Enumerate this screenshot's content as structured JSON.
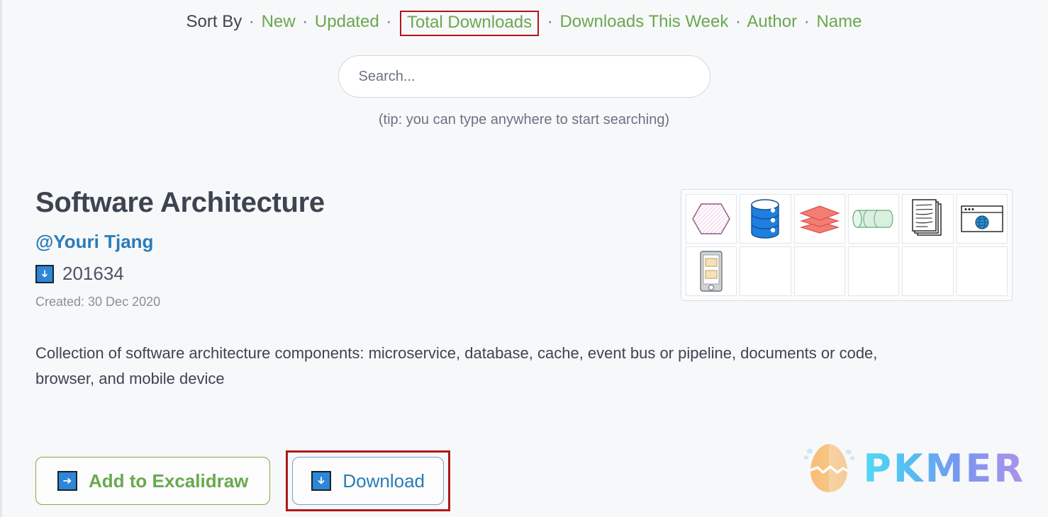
{
  "sort_bar": {
    "label": "Sort By",
    "separator": "·",
    "options": [
      {
        "label": "New",
        "active": false
      },
      {
        "label": "Updated",
        "active": false
      },
      {
        "label": "Total Downloads",
        "active": true
      },
      {
        "label": "Downloads This Week",
        "active": false
      },
      {
        "label": "Author",
        "active": false
      },
      {
        "label": "Name",
        "active": false
      }
    ]
  },
  "search": {
    "placeholder": "Search...",
    "value": "",
    "tip": "(tip: you can type anywhere to start searching)"
  },
  "item": {
    "title": "Software Architecture",
    "author": "@Youri Tjang",
    "downloads": "201634",
    "download_icon": "download-arrow-icon",
    "created": "Created: 30 Dec 2020",
    "description": "Collection of software architecture components: microservice, database, cache, event bus or pipeline, documents or code, browser, and mobile device"
  },
  "thumbnails": [
    {
      "name": "hexagon-microservice-thumb",
      "filled": true
    },
    {
      "name": "database-cylinder-thumb",
      "filled": true
    },
    {
      "name": "cache-layers-thumb",
      "filled": true
    },
    {
      "name": "pipeline-tube-thumb",
      "filled": true
    },
    {
      "name": "documents-stack-thumb",
      "filled": true
    },
    {
      "name": "browser-window-thumb",
      "filled": true
    },
    {
      "name": "mobile-device-thumb",
      "filled": true
    },
    {
      "name": "empty-slot",
      "filled": false
    },
    {
      "name": "empty-slot",
      "filled": false
    },
    {
      "name": "empty-slot",
      "filled": false
    },
    {
      "name": "empty-slot",
      "filled": false
    },
    {
      "name": "empty-slot",
      "filled": false
    }
  ],
  "actions": {
    "add_label": "Add to Excalidraw",
    "add_icon": "arrow-right-icon",
    "download_label": "Download",
    "download_icon": "download-arrow-icon",
    "download_highlighted": true
  },
  "watermark": {
    "text": "PKMER",
    "logo": "cracked-egg-logo"
  },
  "colors": {
    "page_background": "#f7f8fa",
    "sort_link": "#6aa84f",
    "annotation_red": "#b01818",
    "author_blue": "#2a7cb8",
    "icon_blue": "#2e86d6",
    "text_dark": "#3d4451",
    "text_muted": "#8a8f98"
  }
}
